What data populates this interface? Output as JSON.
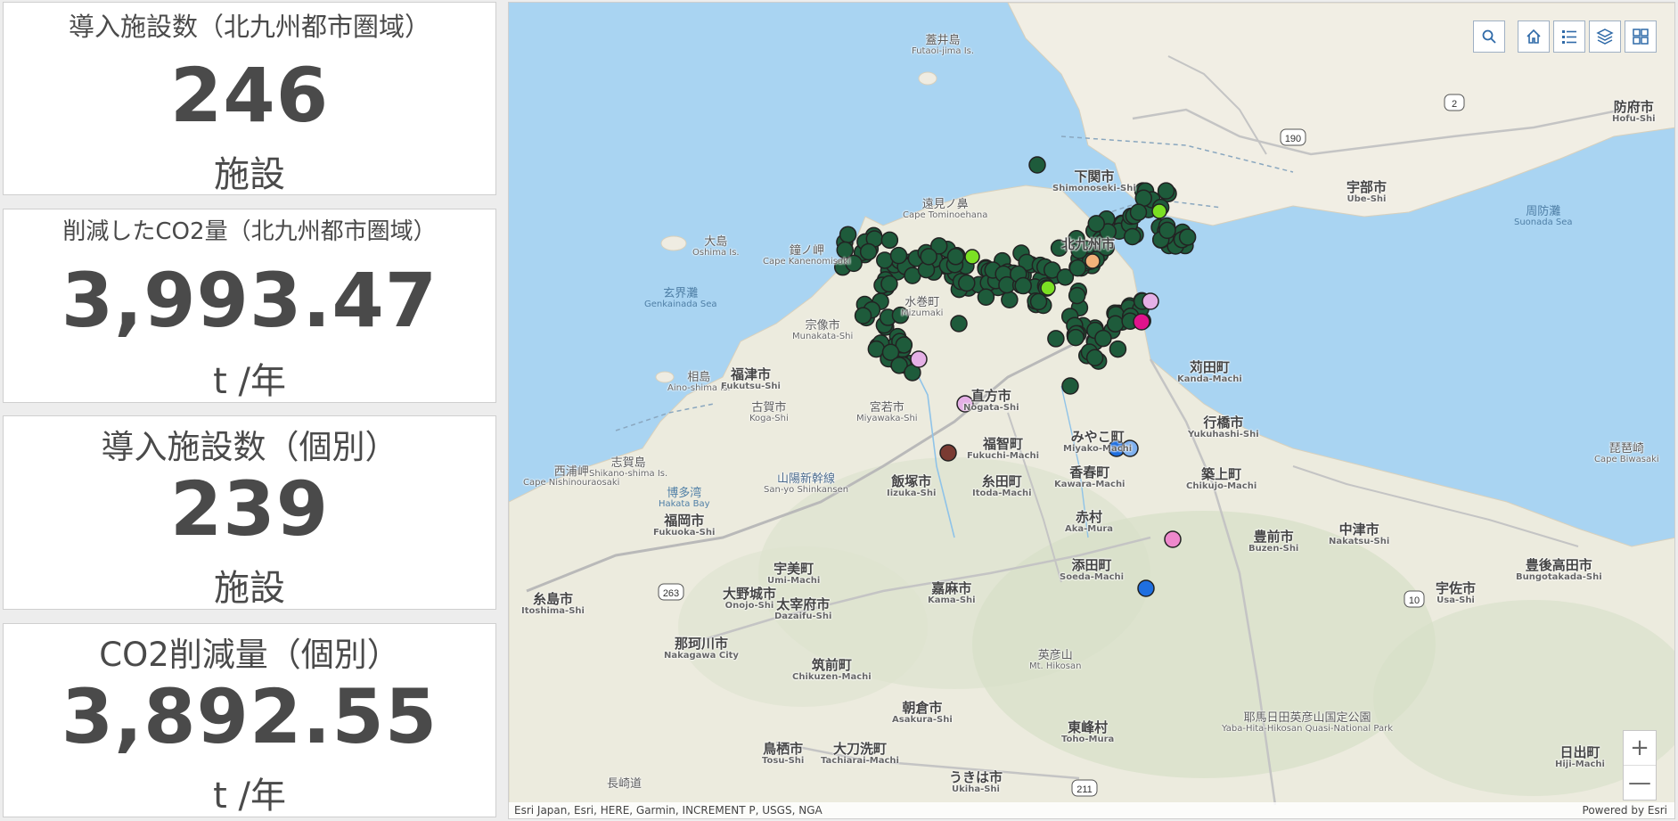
{
  "indicators": [
    {
      "title": "導入施設数（北九州都市圏域）",
      "value": "246",
      "unit": "施設"
    },
    {
      "title": "削減したCO2量（北九州都市圏域）",
      "value": "3,993.47",
      "unit": "t /年"
    },
    {
      "title": "導入施設数（個別）",
      "value": "239",
      "unit": "施設"
    },
    {
      "title": "CO2削減量（個別）",
      "value": "3,892.55",
      "unit": "t /年"
    }
  ],
  "map": {
    "toolbar": [
      "search-icon",
      "home-icon",
      "legend-icon",
      "layers-icon",
      "basemap-gallery-icon"
    ],
    "zoom_in": "+",
    "zoom_out": "—",
    "attribution": "Esri Japan, Esri, HERE, Garmin, INCREMENT P, USGS, NGA",
    "powered_by": "Powered by Esri",
    "places": {
      "futaoijima": {
        "jp": "蓋井島",
        "ro": "Futaoi-jima Is."
      },
      "shimonoseki": {
        "jp": "下関市",
        "ro": "Shimonoseki-Shi"
      },
      "ube": {
        "jp": "宇部市",
        "ro": "Ube-Shi"
      },
      "hofu": {
        "jp": "防府市",
        "ro": "Hofu-Shi"
      },
      "suonada": {
        "jp": "周防灘",
        "ro": "Suonada Sea"
      },
      "tominoe": {
        "jp": "遠見ノ鼻",
        "ro": "Cape Tominoehana"
      },
      "kitakyushu": {
        "jp": "北九州市",
        "ro": ""
      },
      "oshima": {
        "jp": "大島",
        "ro": "Oshima Is."
      },
      "kanenomisaki": {
        "jp": "鐘ノ岬",
        "ro": "Cape Kanenomisaki"
      },
      "genkainada": {
        "jp": "玄界灘",
        "ro": "Genkainada Sea"
      },
      "munakata": {
        "jp": "宗像市",
        "ro": "Munakata-Shi"
      },
      "mizumaki": {
        "jp": "水巻町",
        "ro": "Mizumaki"
      },
      "ainoshima": {
        "jp": "相島",
        "ro": "Aino-shima Is."
      },
      "fukutsu": {
        "jp": "福津市",
        "ro": "Fukutsu-Shi"
      },
      "koga": {
        "jp": "古賀市",
        "ro": "Koga-Shi"
      },
      "miyawaka": {
        "jp": "宮若市",
        "ro": "Miyawaka-Shi"
      },
      "nogata": {
        "jp": "直方市",
        "ro": "Nogata-Shi"
      },
      "kanda": {
        "jp": "苅田町",
        "ro": "Kanda-Machi"
      },
      "yukuhashi": {
        "jp": "行橋市",
        "ro": "Yukuhashi-Shi"
      },
      "fukuchi": {
        "jp": "福智町",
        "ro": "Fukuchi-Machi"
      },
      "miyako": {
        "jp": "みやこ町",
        "ro": "Miyako-Machi"
      },
      "kawara": {
        "jp": "香春町",
        "ro": "Kawara-Machi"
      },
      "itoda": {
        "jp": "糸田町",
        "ro": "Itoda-Machi"
      },
      "iizuka": {
        "jp": "飯塚市",
        "ro": "Iizuka-Shi"
      },
      "chikujo": {
        "jp": "築上町",
        "ro": "Chikujo-Machi"
      },
      "nishiura": {
        "jp": "西浦岬",
        "ro": "Cape Nishinouraosaki"
      },
      "shikanoshima": {
        "jp": "志賀島",
        "ro": "Shikano-shima Is."
      },
      "hakata": {
        "jp": "博多湾",
        "ro": "Hakata Bay"
      },
      "fukuoka": {
        "jp": "福岡市",
        "ro": "Fukuoka-Shi"
      },
      "sanyo": {
        "jp": "山陽新幹線",
        "ro": "San-yo Shinkansen"
      },
      "akamura": {
        "jp": "赤村",
        "ro": "Aka-Mura"
      },
      "buzen": {
        "jp": "豊前市",
        "ro": "Buzen-Shi"
      },
      "nakatsu": {
        "jp": "中津市",
        "ro": "Nakatsu-Shi"
      },
      "bungotakada": {
        "jp": "豊後高田市",
        "ro": "Bungotakada-Shi"
      },
      "usa": {
        "jp": "宇佐市",
        "ro": "Usa-Shi"
      },
      "soeda": {
        "jp": "添田町",
        "ro": "Soeda-Machi"
      },
      "kama": {
        "jp": "嘉麻市",
        "ro": "Kama-Shi"
      },
      "umi": {
        "jp": "宇美町",
        "ro": "Umi-Machi"
      },
      "onojo": {
        "jp": "大野城市",
        "ro": "Onojo-Shi"
      },
      "dazaifu": {
        "jp": "太宰府市",
        "ro": "Dazaifu-Shi"
      },
      "itoshima": {
        "jp": "糸島市",
        "ro": "Itoshima-Shi"
      },
      "nakagawa": {
        "jp": "那珂川市",
        "ro": "Nakagawa City"
      },
      "chikuzen": {
        "jp": "筑前町",
        "ro": "Chikuzen-Machi"
      },
      "asakura": {
        "jp": "朝倉市",
        "ro": "Asakura-Shi"
      },
      "hikosan": {
        "jp": "英彦山",
        "ro": "Mt. Hikosan"
      },
      "toho": {
        "jp": "東峰村",
        "ro": "Toho-Mura"
      },
      "yabahita": {
        "jp": "耶馬日田英彦山国定公園",
        "ro": "Yaba-Hita-Hikosan Quasi-National Park"
      },
      "tosu": {
        "jp": "鳥栖市",
        "ro": "Tosu-Shi"
      },
      "tachiarai": {
        "jp": "大刀洗町",
        "ro": "Tachiarai-Machi"
      },
      "ukiha": {
        "jp": "うきは市",
        "ro": "Ukiha-Shi"
      },
      "hiji": {
        "jp": "日出町",
        "ro": "Hiji-Machi"
      },
      "kitsuki": {
        "jp": "琵琶崎",
        "ro": "Cape Biwasaki"
      },
      "nagasaki": {
        "jp": "長崎道",
        "ro": ""
      },
      "route2": "2",
      "route190": "190",
      "route263": "263",
      "route10": "10",
      "route211": "211"
    }
  }
}
